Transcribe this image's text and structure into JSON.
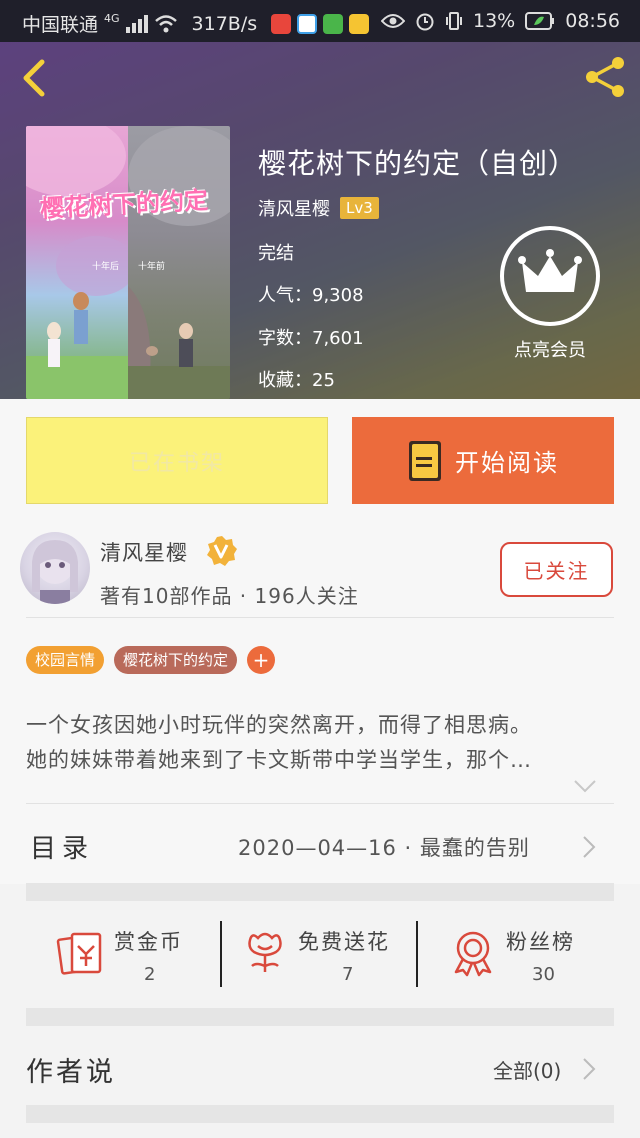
{
  "status_bar": {
    "carrier": "中国联通",
    "network": "4G",
    "speed": "317B/s",
    "battery": "13%",
    "time": "08:56"
  },
  "book": {
    "title": "樱花树下的约定（自创）",
    "cover_title": "樱花树下的约定",
    "cover_left_sub": "十年后",
    "cover_right_sub": "十年前",
    "author": "清风星樱",
    "level": "Lv3",
    "status": "完结",
    "popularity": "人气：9,308",
    "word_count": "字数：7,601",
    "favorites": "收藏：25"
  },
  "vip": {
    "label": "点亮会员"
  },
  "actions": {
    "shelf_label": "已在书架",
    "read_label": "开始阅读"
  },
  "author_row": {
    "name": "清风星樱",
    "stats": "著有10部作品 · 196人关注",
    "follow_label": "已关注"
  },
  "tags": [
    {
      "label": "校园言情",
      "color": "#f2a032"
    },
    {
      "label": "樱花树下的约定",
      "color": "#b96a5a"
    }
  ],
  "tag_add": "+",
  "description": {
    "line1": "一个女孩因她小时玩伴的突然离开，而得了相思病。",
    "line2": "她的妹妹带着她来到了卡文斯带中学当学生，那个…"
  },
  "toc": {
    "label": "目录",
    "latest": "2020—04—16  ·  最蠢的告别"
  },
  "rewards": [
    {
      "label": "赏金币",
      "value": "2",
      "icon": "red-envelope-icon"
    },
    {
      "label": "免费送花",
      "value": "7",
      "icon": "flower-icon"
    },
    {
      "label": "粉丝榜",
      "value": "30",
      "icon": "medal-icon"
    }
  ],
  "author_says": {
    "label": "作者说",
    "all_label": "全部(0)"
  },
  "colors": {
    "accent": "#ec6b3c",
    "shelf_yellow": "#fbf27a",
    "follow_red": "#d9493c",
    "lv_gold": "#e8b43a"
  }
}
